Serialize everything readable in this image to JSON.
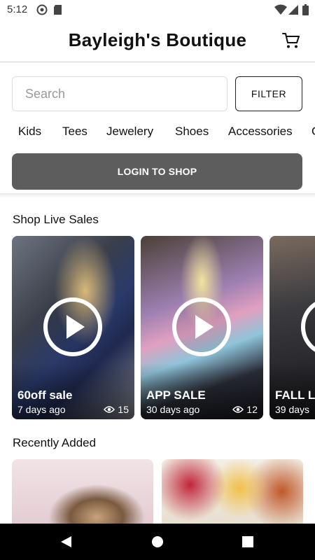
{
  "status_bar": {
    "time": "5:12"
  },
  "header": {
    "title": "Bayleigh's Boutique",
    "cart_icon": "cart-icon"
  },
  "search": {
    "placeholder": "Search",
    "value": ""
  },
  "filter_label": "FILTER",
  "categories": [
    "Kids",
    "Tees",
    "Jewelery",
    "Shoes",
    "Accessories"
  ],
  "login_label": "LOGIN TO SHOP",
  "live_sales": {
    "heading": "Shop Live Sales",
    "cards": [
      {
        "title": "60off sale",
        "age": "7 days ago",
        "views": "15"
      },
      {
        "title": "APP SALE",
        "age": "30 days ago",
        "views": "12"
      },
      {
        "title": "FALL LI",
        "age": "39 days",
        "views": ""
      }
    ]
  },
  "recently_added": {
    "heading": "Recently Added"
  },
  "colors": {
    "login_bg": "#5d5d5d",
    "nav_bg": "#000000"
  }
}
